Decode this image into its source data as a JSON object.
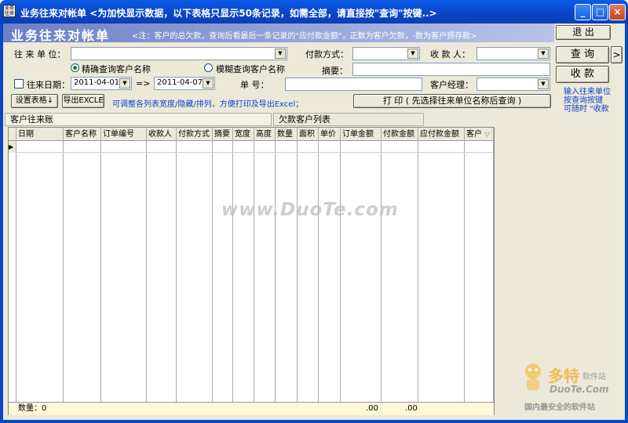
{
  "window": {
    "icon_text": "业务\n往来",
    "title": "业务往来对帐单 <为加快显示数据，以下表格只显示50条记录，如需全部，请直接按\"查询\"按键..>",
    "min_glyph": "_",
    "max_glyph": "□",
    "close_glyph": "×"
  },
  "header": {
    "title": "业务往来对帐单",
    "note": "<注：客户的总欠款，查询后看最后一条记录的\"应付款金额\"，正数为客户欠款，-数为客户预存款>",
    "exit_label": "退 出"
  },
  "filters": {
    "unit_label": "往 来 单 位：",
    "unit_value": "",
    "pay_method_label": "付款方式：",
    "pay_method_value": "",
    "payee_label": "收 款 人：",
    "payee_value": "",
    "radio_exact_label": "精确查询客户名称",
    "radio_exact_checked": true,
    "radio_fuzzy_label": "模糊查询客户名称",
    "radio_fuzzy_checked": false,
    "summary_label": "摘要：",
    "summary_value": "",
    "date_check_label": "往来日期：",
    "date_from": "2011-04-01",
    "date_arrow": "=>",
    "date_to": "2011-04-07",
    "doc_no_label": "单    号：",
    "doc_no_value": "",
    "manager_label": "客户经理：",
    "manager_value": ""
  },
  "toolbar": {
    "set_table_label": "设置表格↓",
    "export_label": "导出EXCLE",
    "hint": "可调整各列表宽度/隐藏/排列，方便打印及导出Excel；",
    "print_label": "打 印 ( 先选择往来单位名称后查询 )",
    "query_label": "查 询",
    "more_label": ">",
    "receive_label": "收  款",
    "side_note_1": "输入往来单位",
    "side_note_2": "按查询按键",
    "side_note_3": "可随时 \"收款"
  },
  "tabs": [
    {
      "label": "客户往来账"
    },
    {
      "label": "欠款客户列表"
    }
  ],
  "grid": {
    "row_marker": "▶",
    "columns": [
      {
        "label": "日期"
      },
      {
        "label": "客户名称"
      },
      {
        "label": "订单编号"
      },
      {
        "label": "收款人"
      },
      {
        "label": "付款方式"
      },
      {
        "label": "摘要"
      },
      {
        "label": "宽度"
      },
      {
        "label": "高度"
      },
      {
        "label": "数量"
      },
      {
        "label": "面积"
      },
      {
        "label": "单价"
      },
      {
        "label": "订单金额"
      },
      {
        "label": "付款金额"
      },
      {
        "label": "应付款金额"
      },
      {
        "label": "客户"
      }
    ],
    "sort_glyph": "▽",
    "footer_count": "数量：0",
    "footer_order_total": ".00",
    "footer_paid_total": ".00"
  },
  "watermark": "www.DuoTe.com",
  "logo": {
    "brand": "多特",
    "brand_sub": "软件站",
    "domain": "DuoTe.Com",
    "slogan": "国内最安全的软件站"
  }
}
